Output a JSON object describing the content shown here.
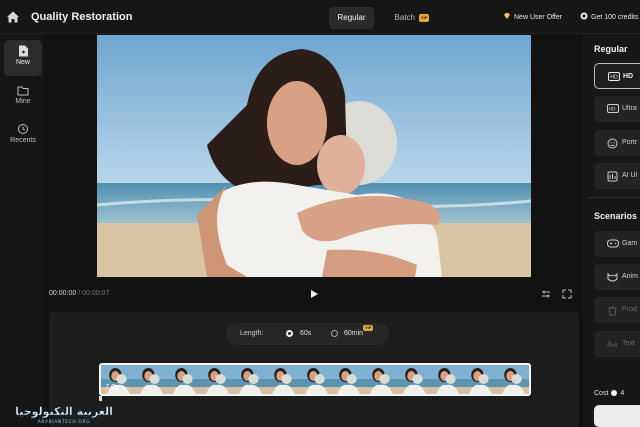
{
  "header": {
    "title": "Quality Restoration",
    "tabs": [
      {
        "label": "Regular",
        "active": true
      },
      {
        "label": "Batch",
        "badge": "VIP",
        "active": false
      }
    ],
    "offer": "New User Offer",
    "credits": "Get 100 credits"
  },
  "sidebar": {
    "items": [
      {
        "label": "New",
        "icon": "file-plus-icon",
        "active": true
      },
      {
        "label": "Mine",
        "icon": "folder-icon",
        "active": false
      },
      {
        "label": "Recents",
        "icon": "history-icon",
        "active": false
      }
    ]
  },
  "player": {
    "current_time": "00:00:00",
    "duration": "/ 00:00:07"
  },
  "timeline": {
    "length_label": "Length:",
    "options": [
      {
        "label": "60s",
        "selected": true
      },
      {
        "label": "60min",
        "badge": "VIP",
        "selected": false
      }
    ],
    "clip_duration": "7.0s",
    "frame_count": 13
  },
  "right_panel": {
    "regular_heading": "Regular",
    "regular_items": [
      {
        "label": "HD",
        "icon": "hd-icon",
        "active": true
      },
      {
        "label": "Ultra",
        "icon": "hd-plus-icon",
        "active": false
      },
      {
        "label": "Portr",
        "icon": "face-icon",
        "active": false
      },
      {
        "label": "AI Ul",
        "icon": "ai-icon",
        "active": false
      }
    ],
    "scenarios_heading": "Scenarios",
    "scenario_items": [
      {
        "label": "Gam",
        "icon": "gamepad-icon",
        "dim": false
      },
      {
        "label": "Anim",
        "icon": "anime-icon",
        "dim": false
      },
      {
        "label": "Prod",
        "icon": "product-icon",
        "dim": true
      },
      {
        "label": "Text",
        "icon": "text-icon",
        "dim": true
      }
    ],
    "cost_label": "Cost",
    "cost_value": "4"
  },
  "watermark": {
    "arabic": "العربية التكنولوجيا",
    "latin": "ARABIANTECH.ORG"
  },
  "colors": {
    "background": "#121212",
    "panel": "#1d1d1d",
    "accent_vip": "#e8a83a",
    "text": "#e8e8e8"
  }
}
